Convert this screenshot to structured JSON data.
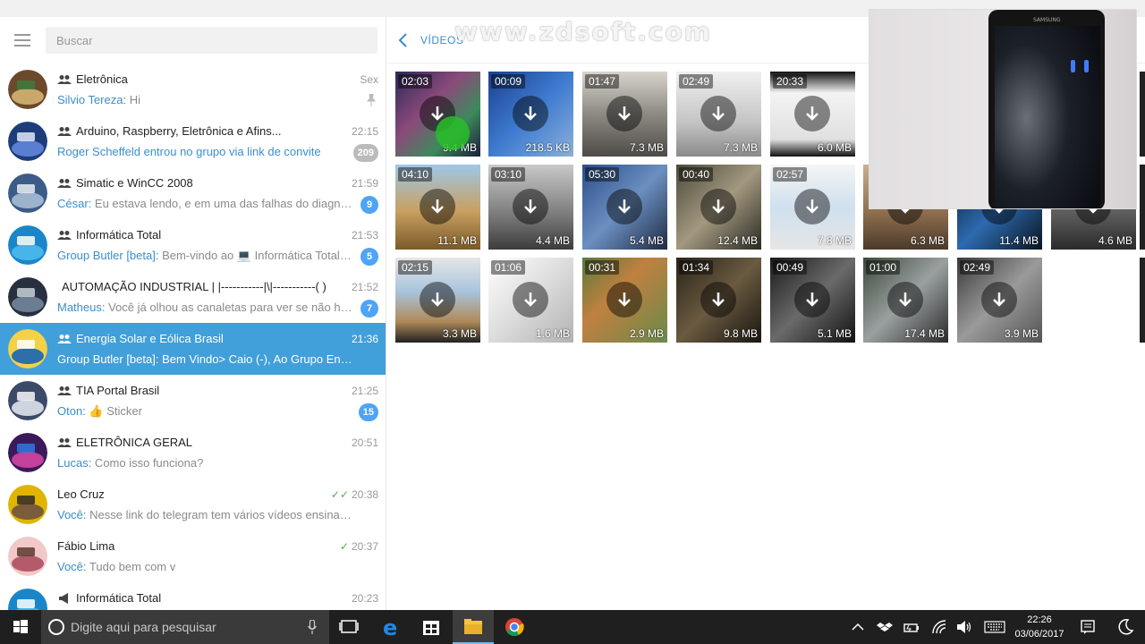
{
  "sidebar": {
    "search_placeholder": "Buscar",
    "chats": [
      {
        "title": "Eletrônica",
        "group": true,
        "time": "Sex",
        "sender": "Silvio Tereza:",
        "preview": " Hi",
        "pinned": true
      },
      {
        "title": "Arduino, Raspberry, Eletrônica e Afins...",
        "group": true,
        "time": "22:15",
        "sender": "",
        "preview": "Roger Scheffeld entrou no grupo via link de convite",
        "badge": "209",
        "muted": true
      },
      {
        "title": "Simatic e WinCC 2008",
        "group": true,
        "time": "21:59",
        "sender": "César:",
        "preview": " Eu estava lendo, e em uma das falhas do diagnóstico...",
        "badge": "9"
      },
      {
        "title": "Informática Total",
        "group": true,
        "time": "21:53",
        "sender": "Group Butler [beta]:",
        "preview": " Bem-vindo ao 💻 Informática Total ...",
        "badge": "5"
      },
      {
        "title": "AUTOMAÇÃO INDUSTRIAL | |-----------|\\|-----------( )",
        "group": true,
        "time": "21:52",
        "sender": "Matheus:",
        "preview": " Você já olhou as canaletas para ver se não há ne...",
        "badge": "7"
      },
      {
        "title": "Energia Solar e Eólica Brasil",
        "group": true,
        "time": "21:36",
        "sender": "Group Butler [beta]:",
        "preview": " Bem Vindo> Caio (-), Ao Grupo Energia Sola...",
        "active": true
      },
      {
        "title": "TIA Portal Brasil",
        "group": true,
        "time": "21:25",
        "sender": "Oton:",
        "preview": " 👍 Sticker",
        "badge": "15"
      },
      {
        "title": "ELETRÔNICA GERAL",
        "group": true,
        "time": "20:51",
        "sender": "Lucas:",
        "preview": " Como isso funciona?"
      },
      {
        "title": "Leo Cruz",
        "group": false,
        "time": "20:38",
        "checks": "✓✓",
        "sender": "Você:",
        "preview": " Nesse link do telegram tem vários vídeos ensinando"
      },
      {
        "title": "Fábio Lima",
        "group": false,
        "time": "20:37",
        "checks": "✓",
        "sender": "Você:",
        "preview": " Tudo bem com v"
      },
      {
        "title": "Informática Total",
        "channel": true,
        "time": "20:23",
        "sender": "",
        "preview": ""
      }
    ]
  },
  "media": {
    "title": "VÍDEOS",
    "watermark": "www.zdsoft.com",
    "videos": [
      {
        "duration": "02:03",
        "size": "9.4 MB"
      },
      {
        "duration": "00:09",
        "size": "218.5 KB"
      },
      {
        "duration": "01:47",
        "size": "7.3 MB"
      },
      {
        "duration": "02:49",
        "size": "7.3 MB"
      },
      {
        "duration": "20:33",
        "size": "6.0 MB"
      },
      {
        "duration": "04:10",
        "size": "11.1 MB"
      },
      {
        "duration": "03:10",
        "size": "4.4 MB"
      },
      {
        "duration": "05:30",
        "size": "5.4 MB"
      },
      {
        "duration": "00:40",
        "size": "12.4 MB"
      },
      {
        "duration": "02:57",
        "size": "7.8 MB"
      },
      {
        "duration": "",
        "size": "6.3 MB"
      },
      {
        "duration": "",
        "size": "11.4 MB"
      },
      {
        "duration": "",
        "size": "4.6 MB"
      },
      {
        "duration": "02:15",
        "size": "3.3 MB"
      },
      {
        "duration": "01:06",
        "size": "1.6 MB"
      },
      {
        "duration": "00:31",
        "size": "2.9 MB"
      },
      {
        "duration": "01:34",
        "size": "9.8 MB"
      },
      {
        "duration": "00:49",
        "size": "5.1 MB"
      },
      {
        "duration": "01:00",
        "size": "17.4 MB"
      },
      {
        "duration": "02:49",
        "size": "3.9 MB"
      }
    ]
  },
  "taskbar": {
    "search_text": "Digite aqui para pesquisar",
    "time": "22:26",
    "date": "03/06/2017"
  }
}
